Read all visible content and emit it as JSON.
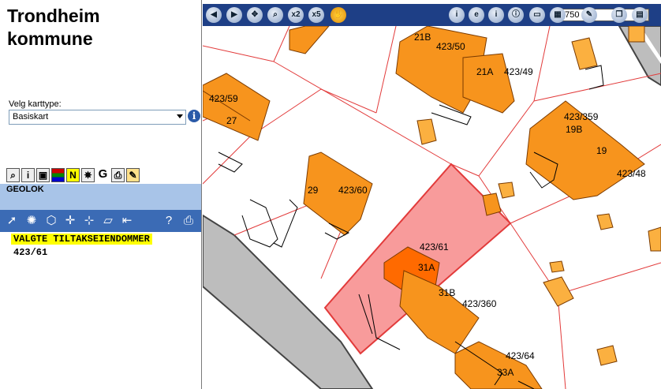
{
  "municipality": {
    "title_line1": "Trondheim",
    "title_line2": "kommune"
  },
  "karttype": {
    "label": "Velg karttype:",
    "selected": "Basiskart"
  },
  "panel": {
    "section_title": "GEOLOK",
    "selected_heading": "VALGTE TILTAKSEIENDOMMER",
    "selected_value": "423/61"
  },
  "toolbar": {
    "scale": "1:750"
  },
  "map": {
    "highlight_color": "#f78a8a",
    "building_color": "#f7941d",
    "parcel_labels": {
      "p423_59": "423/59",
      "p27": "27",
      "p29": "29",
      "p423_60": "423/60",
      "p21B": "21B",
      "p423_50": "423/50",
      "p21A": "21A",
      "p423_49": "423/49",
      "p423_359": "423/359",
      "p19B": "19B",
      "p19": "19",
      "p423_48": "423/48",
      "p423_61": "423/61",
      "p31A": "31A",
      "p31B": "31B",
      "p423_360": "423/360",
      "p423_64": "423/64",
      "p33A": "33A"
    }
  }
}
